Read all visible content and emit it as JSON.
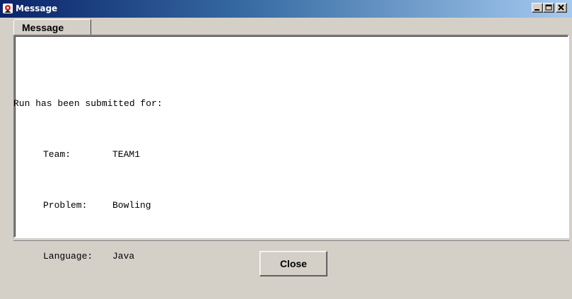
{
  "window": {
    "title": "Message",
    "app_icon": "java-duke-icon",
    "controls": [
      "minimize-icon",
      "maximize-icon",
      "close-icon"
    ],
    "titlebar_color_start": "#0a246a",
    "titlebar_color_end": "#a6caf0"
  },
  "tabs": [
    {
      "label": "Message",
      "selected": true
    }
  ],
  "message": {
    "intro": "Run has been submitted for:",
    "fields": [
      {
        "label": "Team:",
        "value": "TEAM1"
      },
      {
        "label": "Problem:",
        "value": "Bowling"
      },
      {
        "label": "Language:",
        "value": "Java"
      }
    ]
  },
  "buttons": {
    "close_label": "Close"
  }
}
